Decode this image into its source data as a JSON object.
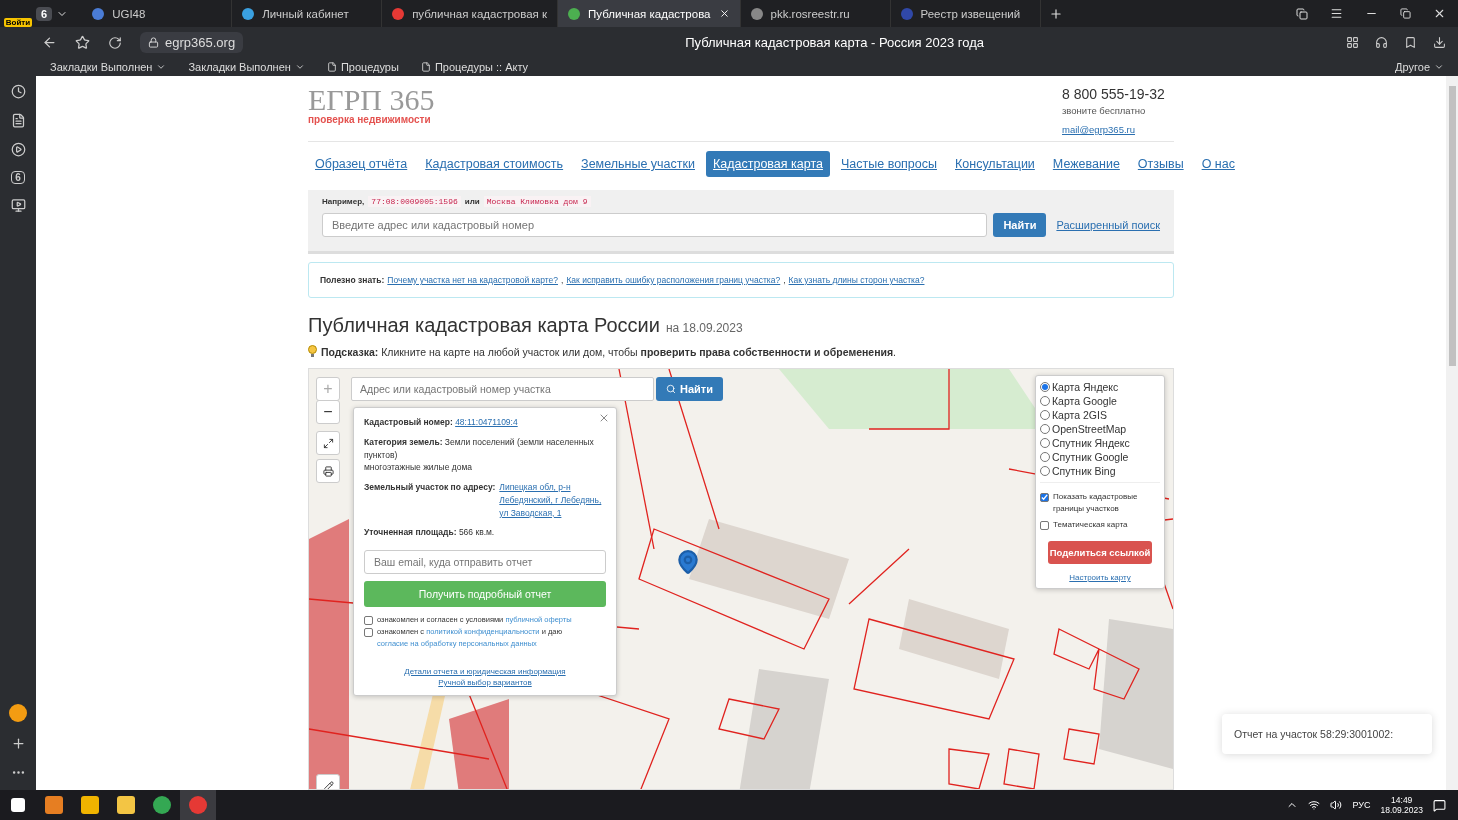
{
  "browser": {
    "profile_label": "Войти",
    "tab_count": "6",
    "tabs": [
      {
        "title": "UGI48",
        "selected": false
      },
      {
        "title": "Личный кабинет",
        "selected": false
      },
      {
        "title": "публичная кадастровая к",
        "selected": false
      },
      {
        "title": "Публичная кадастрова",
        "selected": true
      },
      {
        "title": "pkk.rosreestr.ru",
        "selected": false
      },
      {
        "title": "Реестр извещений",
        "selected": false
      }
    ],
    "url": "egrp365.org",
    "page_title": "Публичная кадастровая карта - Россия 2023 года",
    "bookmarks": [
      "Закладки Выполнен",
      "Закладки Выполнен",
      "Процедуры",
      "Процедуры :: Акту"
    ],
    "other_bookmarks": "Другое",
    "sidebar_badge": "6"
  },
  "site": {
    "logo": "ЕГРП 365",
    "tagline": "проверка недвижимости",
    "phone": "8 800 555-19-32",
    "phone_note": "звоните бесплатно",
    "email": "mail@egrp365.ru"
  },
  "nav": [
    {
      "label": "Образец отчёта",
      "selected": false
    },
    {
      "label": "Кадастровая стоимость",
      "selected": false
    },
    {
      "label": "Земельные участки",
      "selected": false
    },
    {
      "label": "Кадастровая карта",
      "selected": true
    },
    {
      "label": "Частые вопросы",
      "selected": false
    },
    {
      "label": "Консультации",
      "selected": false
    },
    {
      "label": "Межевание",
      "selected": false
    },
    {
      "label": "Отзывы",
      "selected": false
    },
    {
      "label": "О нас",
      "selected": false
    }
  ],
  "search": {
    "example_label": "Например,",
    "example_1": "77:08:0009005:1596",
    "or": "или",
    "example_2": "Москва Климовка дом 9",
    "placeholder": "Введите адрес или кадастровый номер",
    "button": "Найти",
    "advanced_link": "Расширенный поиск"
  },
  "useful": {
    "label": "Полезно знать:",
    "links": [
      {
        "text": "Почему участка нет на кадастровой карте?",
        "after": ","
      },
      {
        "text": "Как исправить ошибку расположения границ участка?",
        "after": ","
      },
      {
        "text": "Как узнать длины сторон участка?"
      }
    ]
  },
  "heading": {
    "title": "Публичная кадастровая карта России",
    "date": "на 18.09.2023"
  },
  "hint": "**Подсказка:** Кликните на карте на любой участок или дом, чтобы **проверить права собственности и обременения**.",
  "map": {
    "search_placeholder": "Адрес или кадастровый номер участка",
    "search_button": "Найти",
    "zoom_in": "+",
    "zoom_out": "−",
    "popup": {
      "number_label": "Кадастровый номер:",
      "number": "48:11:0471109:4",
      "category_label": "Категория земель:",
      "category": "Земли поселений (земли населенных пунктов)",
      "usage": "многоэтажные жилые дома",
      "address_label": "Земельный участок по адресу:",
      "address": "Липецкая обл, р-н Лебедянский, г Лебедянь, ул Заводская, 1",
      "area_label": "Уточненная площадь:",
      "area": "566 кв.м.",
      "email_placeholder": "Ваш email, куда отправить отчет",
      "submit": "Получить подробный отчет",
      "consents": [
        {
          "checked": false,
          "parts": [
            "ознакомлен и согласен с условиями ",
            "публичной оферты"
          ]
        },
        {
          "checked": false,
          "parts": [
            "ознакомлен с ",
            "политикой конфиденциальности",
            " и даю ",
            "согласие на обработку персональных данных"
          ]
        }
      ],
      "footer_links": [
        "Детали отчета и юридическая информация",
        "Ручной выбор вариантов"
      ]
    },
    "layers": [
      {
        "label": "Карта Яндекс",
        "selected": true
      },
      {
        "label": "Карта Google",
        "selected": false
      },
      {
        "label": "Карта 2GIS",
        "selected": false
      },
      {
        "label": "OpenStreetMap",
        "selected": false
      },
      {
        "label": "Спутник Яндекс",
        "selected": false
      },
      {
        "label": "Спутник Google",
        "selected": false
      },
      {
        "label": "Спутник Bing",
        "selected": false
      }
    ],
    "options": [
      {
        "label": "Показать кадастровые границы участков",
        "checked": true
      },
      {
        "label": "Тематическая карта",
        "checked": false
      }
    ],
    "share_button": "Поделиться ссылкой",
    "settings_link": "Настроить карту"
  },
  "toast": {
    "text": "Отчет на участок 58:29:3001002:"
  },
  "taskbar": {
    "language": "РУС",
    "time": "14:49",
    "date": "18.09.2023"
  }
}
